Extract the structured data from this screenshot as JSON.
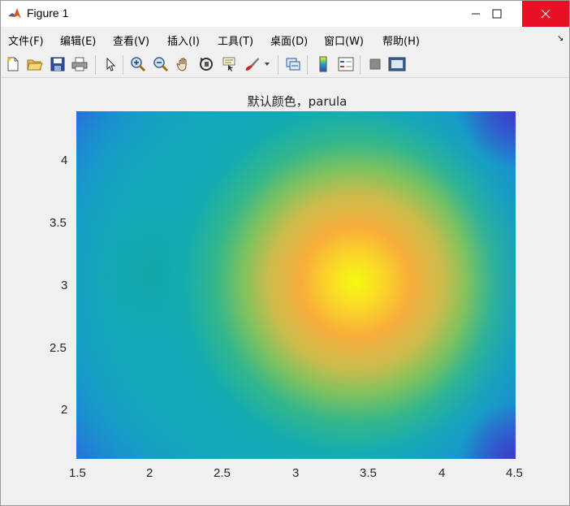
{
  "window": {
    "title": "Figure 1",
    "minimize_glyph": "—",
    "close_glyph": "✕"
  },
  "menu": {
    "items": [
      {
        "label": "文件(F)"
      },
      {
        "label": "编辑(E)"
      },
      {
        "label": "查看(V)"
      },
      {
        "label": "插入(I)"
      },
      {
        "label": "工具(T)"
      },
      {
        "label": "桌面(D)"
      },
      {
        "label": "窗口(W)"
      },
      {
        "label": "帮助(H)"
      }
    ],
    "overflow_glyph": "↘"
  },
  "toolbar": {
    "icons": [
      "new-figure-icon",
      "open-file-icon",
      "save-icon",
      "print-icon",
      "select-arrow-icon",
      "zoom-in-icon",
      "zoom-out-icon",
      "pan-hand-icon",
      "rotate-3d-icon",
      "data-cursor-icon",
      "brush-icon",
      "link-plot-icon",
      "colorbar-icon",
      "legend-icon",
      "hide-plot-tools-icon",
      "show-plot-tools-icon"
    ]
  },
  "plot": {
    "title": "默认颜色，parula",
    "colormap": "parula",
    "colors": {
      "dark_blue": "#3d3bc9",
      "blue": "#1e7fdc",
      "teal": "#12aab9",
      "green": "#6cc466",
      "orange": "#f5a93a",
      "yellow": "#f5f90f"
    }
  },
  "chart_data": {
    "type": "heatmap",
    "title": "默认颜色，parula",
    "colormap": "parula",
    "xlim": [
      1.5,
      4.5
    ],
    "ylim": [
      1.6,
      4.4
    ],
    "x_ticks": [
      "1.5",
      "2",
      "2.5",
      "3",
      "3.5",
      "4",
      "4.5"
    ],
    "y_ticks": [
      "2",
      "2.5",
      "3",
      "3.5",
      "4"
    ],
    "grid": false
  }
}
